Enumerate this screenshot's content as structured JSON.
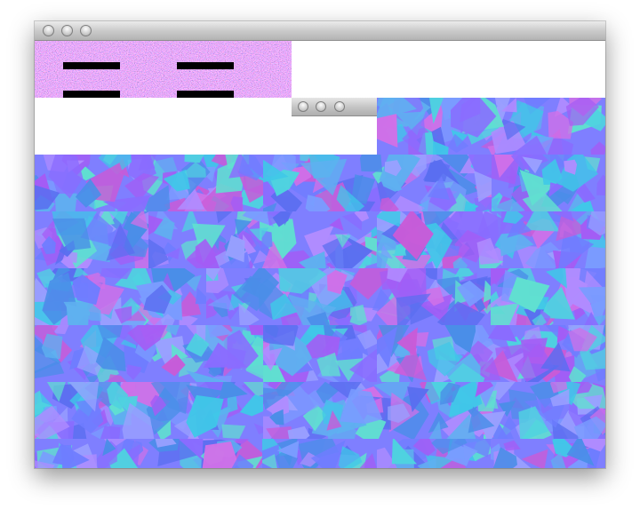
{
  "window": {
    "title": "",
    "buttons": [
      "close",
      "minimize",
      "zoom"
    ]
  },
  "child_window": {
    "title": "",
    "buttons": [
      "close",
      "minimize",
      "zoom"
    ]
  },
  "icons": {
    "close": "close-icon",
    "minimize": "minimize-icon",
    "zoom": "zoom-icon"
  },
  "colors": {
    "noise_base": "#7a3f8c",
    "normal_map_base": "#7f7fff",
    "bar": "#000000",
    "titlebar_top": "#ebebeb",
    "titlebar_bottom": "#b3b3b3"
  }
}
